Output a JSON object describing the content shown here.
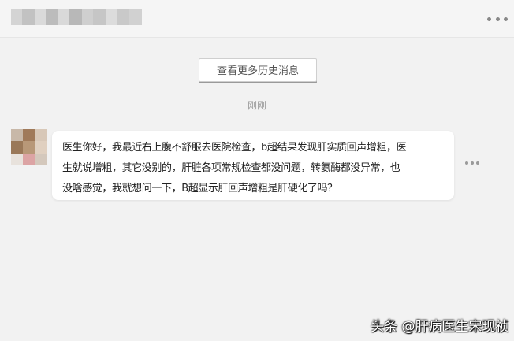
{
  "header": {
    "name_blur_colors": [
      "#d4d4d4",
      "#c2c2c2",
      "#dadada",
      "#bcbcbc",
      "#d9d9d9",
      "#b8b8b8",
      "#cfcfcf",
      "#c6c6c6",
      "#dcdcdc",
      "#c9c9c9",
      "#d1d1d1"
    ],
    "menu_icon": "more-dots-icon"
  },
  "chat": {
    "history_button_label": "查看更多历史消息",
    "timestamp": "刚刚",
    "avatar_mosaic_colors": [
      "#c8b8a8",
      "#a07a5a",
      "#d8c8b8",
      "#9a7858",
      "#b89878",
      "#e0d0c0",
      "#e8e2dc",
      "#dca4a4",
      "#d4c8bc"
    ],
    "message": {
      "lines": [
        "医生你好，我最近右上腹不舒服去医院检查，b超结果发现肝实质回声增粗，医",
        "生就说增粗，其它没别的，肝脏各项常规检查都没问题，转氨酶都没异常，也",
        "没啥感觉，我就想问一下，B超显示肝回声增粗是肝硬化了吗？"
      ]
    },
    "message_more_icon": "more-dots-icon"
  },
  "watermark": "头条 @肝病医生宋现祯"
}
